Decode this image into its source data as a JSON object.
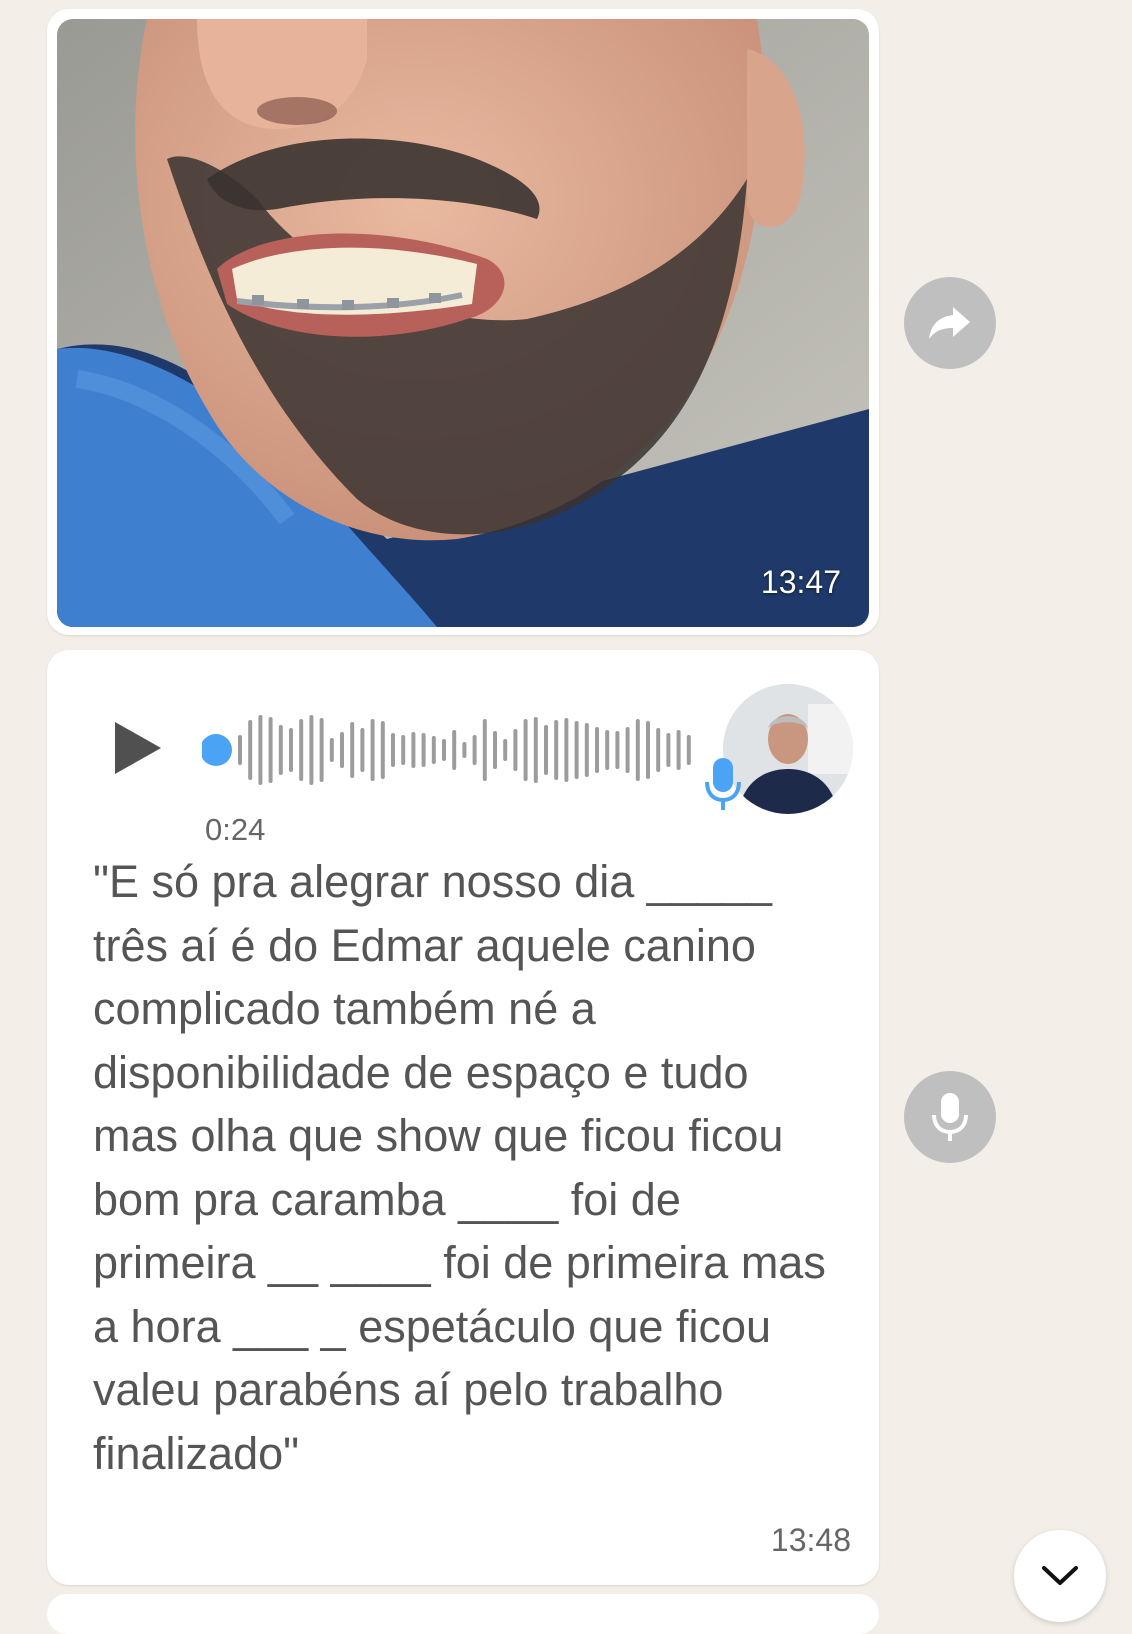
{
  "image_message": {
    "time": "13:47",
    "photo_description_icon": "photo"
  },
  "voice_message": {
    "duration": "0:24",
    "transcript": "\"E só pra alegrar nosso dia _____ três aí é do Edmar aquele canino complicado também né a disponibilidade de espaço e tudo mas olha que show que ficou ficou bom pra caramba ____ foi de primeira __ ____ foi de primeira mas a hora ___ _ espetáculo que ficou valeu parabéns aí pelo trabalho finalizado\"",
    "time": "13:48",
    "play_icon": "play-icon",
    "mic_icon": "microphone-icon"
  },
  "side_actions": {
    "forward_icon": "forward-icon",
    "transcribe_icon": "microphone-icon"
  },
  "scroll_down_icon": "chevron-down-icon",
  "colors": {
    "background": "#f3efe8",
    "bubble": "#ffffff",
    "accent_blue": "#4aa3f5",
    "waveform": "#9c9c9c",
    "side_button": "#bfbfbf"
  }
}
